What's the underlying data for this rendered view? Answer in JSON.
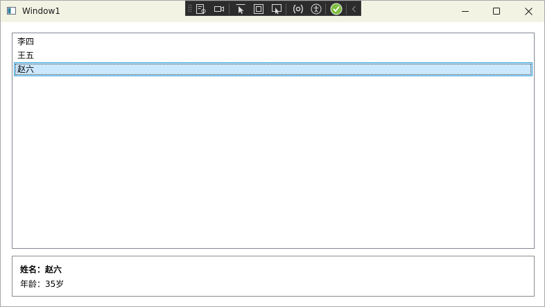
{
  "window": {
    "title": "Window1",
    "buttons": {
      "minimize_icon": "minimize-icon",
      "maximize_icon": "maximize-icon",
      "close_icon": "close-icon"
    }
  },
  "dev_toolbar": {
    "icons": [
      "live-visual-tree-icon",
      "record-icon",
      "select-element-icon",
      "display-layout-adorners-icon",
      "track-focus-icon",
      "binding-failures-icon",
      "accessibility-icon",
      "hot-reload-status-icon",
      "collapse-toolbar-icon"
    ]
  },
  "list": {
    "items": [
      {
        "label": "李四",
        "selected": false
      },
      {
        "label": "王五",
        "selected": false
      },
      {
        "label": "赵六",
        "selected": true
      }
    ]
  },
  "detail": {
    "name_line": "姓名：赵六",
    "age_line": "年龄：35岁"
  },
  "colors": {
    "titlebar_bg": "#f3f3e4",
    "selection_bg": "#cce8ff",
    "selection_border": "#26a0da",
    "toolbar_bg": "#2c2c2c",
    "hot_reload_ok": "#7fbf3f"
  }
}
